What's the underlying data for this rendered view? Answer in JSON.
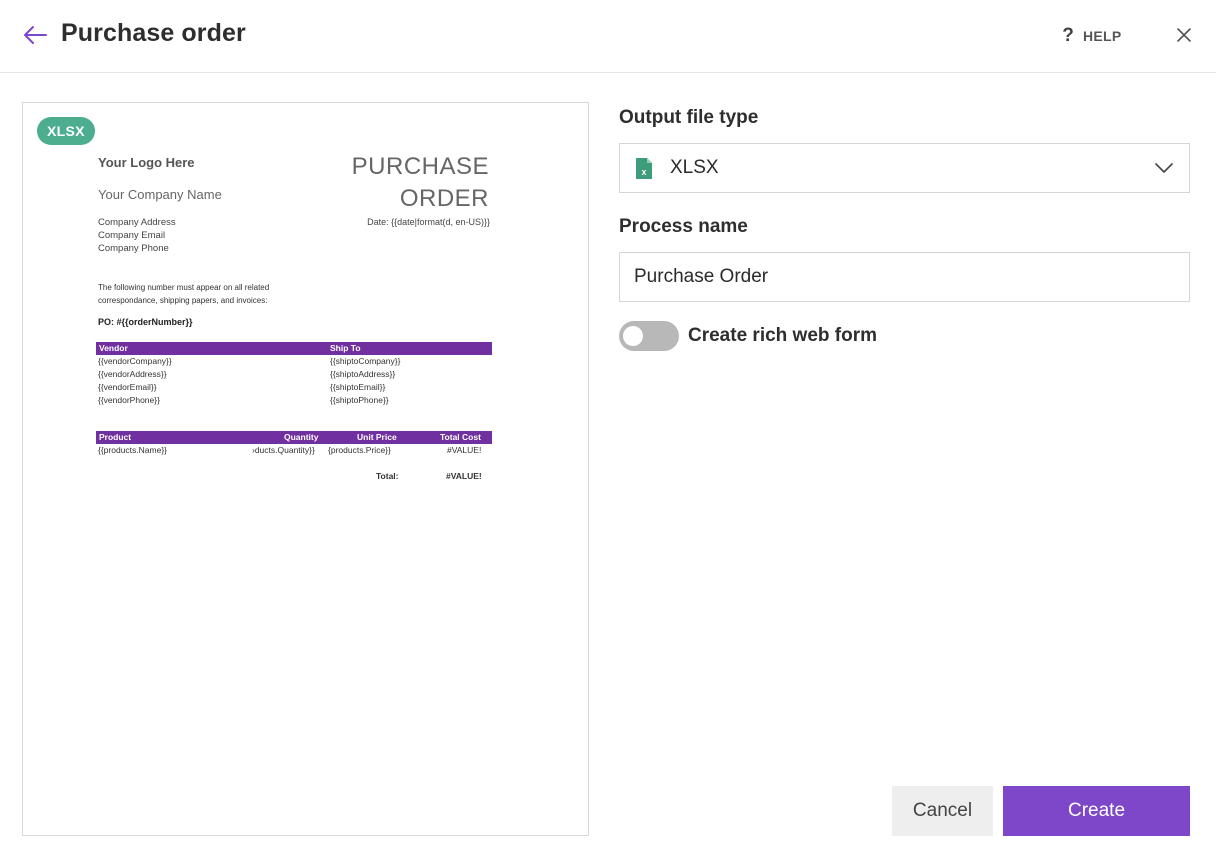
{
  "header": {
    "title": "Purchase order",
    "help_label": "HELP",
    "icons": {
      "back": "arrow-left-icon",
      "help": "question-mark-icon",
      "close": "close-icon"
    }
  },
  "preview": {
    "badge": "XLSX",
    "document": {
      "logo": "Your Logo Here",
      "company_name": "Your Company Name",
      "company_address": "Company Address",
      "company_email": "Company Email",
      "company_phone": "Company Phone",
      "title_line1": "PURCHASE",
      "title_line2": "ORDER",
      "date": "Date: {{date|format(d, en-US)}}",
      "note_line1": "The following number must appear on all related",
      "note_line2": "correspondance, shipping papers, and invoices:",
      "po": "PO: #{{orderNumber}}",
      "vendor_header": "Vendor",
      "shipto_header": "Ship To",
      "vendor_rows": [
        "{{vendorCompany}}",
        "{{vendorAddress}}",
        "{{vendorEmail}}",
        "{{vendorPhone}}"
      ],
      "shipto_rows": [
        "{{shiptoCompany}}",
        "{{shiptoAddress}}",
        "{{shiptoEmail}}",
        "{{shiptoPhone}}"
      ],
      "product_headers": [
        "Product",
        "Quantity",
        "Unit Price",
        "Total Cost"
      ],
      "product_row": [
        "{{products.Name}}",
        "›ducts.Quantity}}",
        "{products.Price}}",
        "#VALUE!"
      ],
      "total_label": "Total:",
      "total_value": "#VALUE!"
    }
  },
  "form": {
    "output_type_label": "Output file type",
    "output_type_value": "XLSX",
    "output_type_icon": "xlsx-file-icon",
    "process_name_label": "Process name",
    "process_name_value": "Purchase Order",
    "rich_form_label": "Create rich web form",
    "rich_form_enabled": false
  },
  "actions": {
    "cancel_label": "Cancel",
    "create_label": "Create"
  },
  "colors": {
    "accent": "#7e47c9",
    "badge": "#4cae8f",
    "table_header": "#7030a0",
    "file_icon": "#3d9d7b"
  }
}
